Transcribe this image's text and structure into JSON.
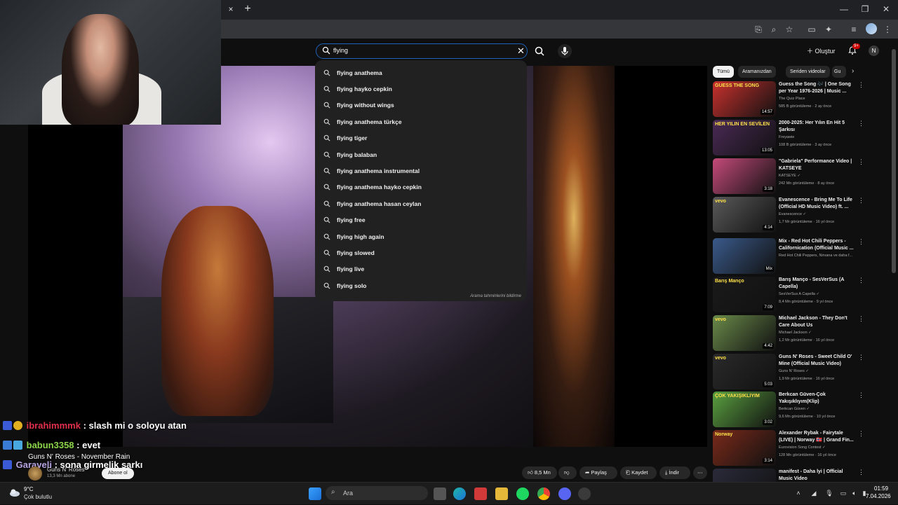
{
  "browser": {
    "tab_close": "×",
    "tab_new": "+",
    "window_controls": [
      "—",
      "❐",
      "✕"
    ]
  },
  "youtube": {
    "search": {
      "query": "flying",
      "suggestions": [
        "flying anathema",
        "flying hayko cepkin",
        "flying without wings",
        "flying anathema türkçe",
        "flying tiger",
        "flying balaban",
        "flying anathema instrumental",
        "flying anathema hayko cepkin",
        "flying anathema hasan ceylan",
        "flying free",
        "flying high again",
        "flying slowed",
        "flying live",
        "flying solo"
      ],
      "report_label": "Arama tahminlerini bildirme"
    },
    "create_label": "Oluştur",
    "notification_badge": "9+",
    "avatar_letter": "N"
  },
  "chat": [
    {
      "user": "ibrahimmmk",
      "message": ": slash mi o soloyu atan"
    },
    {
      "user": "babun3358",
      "message": ": evet"
    },
    {
      "user": "Garaveli",
      "message": ": sona girmelik şarkı"
    }
  ],
  "video": {
    "title": "Guns N' Roses - November Rain",
    "channel": "Guns N' Roses",
    "subscribers": "13,3 Mn abone",
    "subscribe_label": "Abone ol",
    "likes": "8,5 Mn",
    "share_label": "Paylaş",
    "save_label": "Kaydet",
    "download_label": "İndir"
  },
  "sidebar": {
    "chips": [
      "Tümü",
      "Aramanızdan",
      "Seriden videolar",
      "Gu"
    ],
    "recommendations": [
      {
        "title": "Guess the Song 🎶 | One Song per Year 1976-2026 | Music ...",
        "channel": "The Quiz Place",
        "meta": "585 B görüntüleme · 2 ay önce",
        "duration": "14:57",
        "thumb_color": "#c8312e",
        "thumb_text": "GUESS THE SONG"
      },
      {
        "title": "2000-2025: Her Yılın En Hit 5 Şarkısı",
        "channel": "Freyawie",
        "meta": "108 B görüntüleme · 3 ay önce",
        "duration": "13:05",
        "thumb_color": "#4a2a55",
        "thumb_text": "HER YILIN EN SEVİLEN"
      },
      {
        "title": "\"Gabriela\" Performance Video | KATSEYE",
        "channel": "KATSEYE ✓",
        "meta": "242 Mn görüntüleme · 8 ay önce",
        "duration": "3:18",
        "thumb_color": "#c44a7a",
        "thumb_text": ""
      },
      {
        "title": "Evanescence - Bring Me To Life (Official HD Music Video) ft. ...",
        "channel": "Evanescence ✓",
        "meta": "1,7 Mr görüntüleme · 16 yıl önce",
        "duration": "4:14",
        "thumb_color": "#5a5a5a",
        "thumb_text": "vevo"
      },
      {
        "title": "Mix - Red Hot Chili Peppers - Californication (Official Music ...",
        "channel": "Red Hot Chili Peppers, Nirvana ve daha f...",
        "meta": "",
        "duration": "Mix",
        "thumb_color": "#3a5a8a",
        "thumb_text": ""
      },
      {
        "title": "Barış Manço - SesVerSus (A Capella)",
        "channel": "SesVerSus A Capella ✓",
        "meta": "8,4 Mn görüntüleme · 9 yıl önce",
        "duration": "7:09",
        "thumb_color": "#1a1a1a",
        "thumb_text": "Barış Manço"
      },
      {
        "title": "Michael Jackson - They Don't Care About Us",
        "channel": "Michael Jackson ✓",
        "meta": "1,2 Mr görüntüleme · 16 yıl önce",
        "duration": "4:42",
        "thumb_color": "#6a8a4a",
        "thumb_text": "vevo"
      },
      {
        "title": "Guns N' Roses - Sweet Child O' Mine (Official Music Video)",
        "channel": "Guns N' Roses ✓",
        "meta": "1,9 Mr görüntüleme · 16 yıl önce",
        "duration": "5:03",
        "thumb_color": "#2a2a2a",
        "thumb_text": "vevo"
      },
      {
        "title": "Berkcan Güven-Çok Yakışıklıyım(Klip)",
        "channel": "Berkcan Güven ✓",
        "meta": "9,6 Mn görüntüleme · 10 yıl önce",
        "duration": "3:02",
        "thumb_color": "#5aa040",
        "thumb_text": "ÇOK YAKIŞIKLIYIM"
      },
      {
        "title": "Alexander Rybak - Fairytale (LIVE) | Norway 🇳🇴 | Grand Fin...",
        "channel": "Eurovision Song Contest ✓",
        "meta": "128 Mn görüntüleme · 16 yıl önce",
        "duration": "3:14",
        "thumb_color": "#7a2a1a",
        "thumb_text": "Norway"
      },
      {
        "title": "manifest - Daha İyi | Official Music Video",
        "channel": "",
        "meta": "",
        "duration": "",
        "thumb_color": "#2a2a3a",
        "thumb_text": ""
      }
    ]
  },
  "taskbar": {
    "temperature": "9°C",
    "weather": "Çok bulutlu",
    "search_label": "Ara",
    "time": "01:59",
    "date": "7.04.2026"
  }
}
